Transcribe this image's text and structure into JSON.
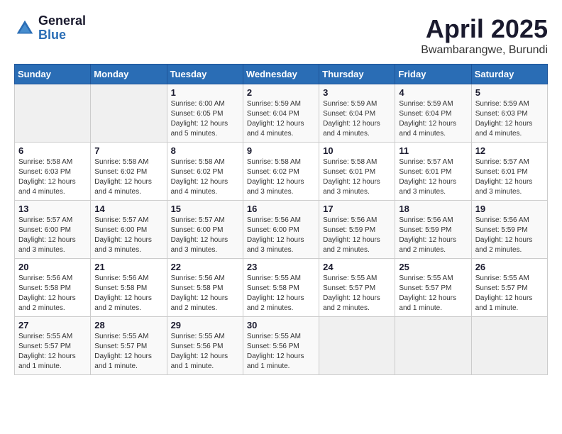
{
  "logo": {
    "general": "General",
    "blue": "Blue"
  },
  "title": {
    "month": "April 2025",
    "location": "Bwambarangwe, Burundi"
  },
  "headers": [
    "Sunday",
    "Monday",
    "Tuesday",
    "Wednesday",
    "Thursday",
    "Friday",
    "Saturday"
  ],
  "weeks": [
    [
      {
        "day": "",
        "info": ""
      },
      {
        "day": "",
        "info": ""
      },
      {
        "day": "1",
        "info": "Sunrise: 6:00 AM\nSunset: 6:05 PM\nDaylight: 12 hours\nand 5 minutes."
      },
      {
        "day": "2",
        "info": "Sunrise: 5:59 AM\nSunset: 6:04 PM\nDaylight: 12 hours\nand 4 minutes."
      },
      {
        "day": "3",
        "info": "Sunrise: 5:59 AM\nSunset: 6:04 PM\nDaylight: 12 hours\nand 4 minutes."
      },
      {
        "day": "4",
        "info": "Sunrise: 5:59 AM\nSunset: 6:04 PM\nDaylight: 12 hours\nand 4 minutes."
      },
      {
        "day": "5",
        "info": "Sunrise: 5:59 AM\nSunset: 6:03 PM\nDaylight: 12 hours\nand 4 minutes."
      }
    ],
    [
      {
        "day": "6",
        "info": "Sunrise: 5:58 AM\nSunset: 6:03 PM\nDaylight: 12 hours\nand 4 minutes."
      },
      {
        "day": "7",
        "info": "Sunrise: 5:58 AM\nSunset: 6:02 PM\nDaylight: 12 hours\nand 4 minutes."
      },
      {
        "day": "8",
        "info": "Sunrise: 5:58 AM\nSunset: 6:02 PM\nDaylight: 12 hours\nand 4 minutes."
      },
      {
        "day": "9",
        "info": "Sunrise: 5:58 AM\nSunset: 6:02 PM\nDaylight: 12 hours\nand 3 minutes."
      },
      {
        "day": "10",
        "info": "Sunrise: 5:58 AM\nSunset: 6:01 PM\nDaylight: 12 hours\nand 3 minutes."
      },
      {
        "day": "11",
        "info": "Sunrise: 5:57 AM\nSunset: 6:01 PM\nDaylight: 12 hours\nand 3 minutes."
      },
      {
        "day": "12",
        "info": "Sunrise: 5:57 AM\nSunset: 6:01 PM\nDaylight: 12 hours\nand 3 minutes."
      }
    ],
    [
      {
        "day": "13",
        "info": "Sunrise: 5:57 AM\nSunset: 6:00 PM\nDaylight: 12 hours\nand 3 minutes."
      },
      {
        "day": "14",
        "info": "Sunrise: 5:57 AM\nSunset: 6:00 PM\nDaylight: 12 hours\nand 3 minutes."
      },
      {
        "day": "15",
        "info": "Sunrise: 5:57 AM\nSunset: 6:00 PM\nDaylight: 12 hours\nand 3 minutes."
      },
      {
        "day": "16",
        "info": "Sunrise: 5:56 AM\nSunset: 6:00 PM\nDaylight: 12 hours\nand 3 minutes."
      },
      {
        "day": "17",
        "info": "Sunrise: 5:56 AM\nSunset: 5:59 PM\nDaylight: 12 hours\nand 2 minutes."
      },
      {
        "day": "18",
        "info": "Sunrise: 5:56 AM\nSunset: 5:59 PM\nDaylight: 12 hours\nand 2 minutes."
      },
      {
        "day": "19",
        "info": "Sunrise: 5:56 AM\nSunset: 5:59 PM\nDaylight: 12 hours\nand 2 minutes."
      }
    ],
    [
      {
        "day": "20",
        "info": "Sunrise: 5:56 AM\nSunset: 5:58 PM\nDaylight: 12 hours\nand 2 minutes."
      },
      {
        "day": "21",
        "info": "Sunrise: 5:56 AM\nSunset: 5:58 PM\nDaylight: 12 hours\nand 2 minutes."
      },
      {
        "day": "22",
        "info": "Sunrise: 5:56 AM\nSunset: 5:58 PM\nDaylight: 12 hours\nand 2 minutes."
      },
      {
        "day": "23",
        "info": "Sunrise: 5:55 AM\nSunset: 5:58 PM\nDaylight: 12 hours\nand 2 minutes."
      },
      {
        "day": "24",
        "info": "Sunrise: 5:55 AM\nSunset: 5:57 PM\nDaylight: 12 hours\nand 2 minutes."
      },
      {
        "day": "25",
        "info": "Sunrise: 5:55 AM\nSunset: 5:57 PM\nDaylight: 12 hours\nand 1 minute."
      },
      {
        "day": "26",
        "info": "Sunrise: 5:55 AM\nSunset: 5:57 PM\nDaylight: 12 hours\nand 1 minute."
      }
    ],
    [
      {
        "day": "27",
        "info": "Sunrise: 5:55 AM\nSunset: 5:57 PM\nDaylight: 12 hours\nand 1 minute."
      },
      {
        "day": "28",
        "info": "Sunrise: 5:55 AM\nSunset: 5:57 PM\nDaylight: 12 hours\nand 1 minute."
      },
      {
        "day": "29",
        "info": "Sunrise: 5:55 AM\nSunset: 5:56 PM\nDaylight: 12 hours\nand 1 minute."
      },
      {
        "day": "30",
        "info": "Sunrise: 5:55 AM\nSunset: 5:56 PM\nDaylight: 12 hours\nand 1 minute."
      },
      {
        "day": "",
        "info": ""
      },
      {
        "day": "",
        "info": ""
      },
      {
        "day": "",
        "info": ""
      }
    ]
  ]
}
